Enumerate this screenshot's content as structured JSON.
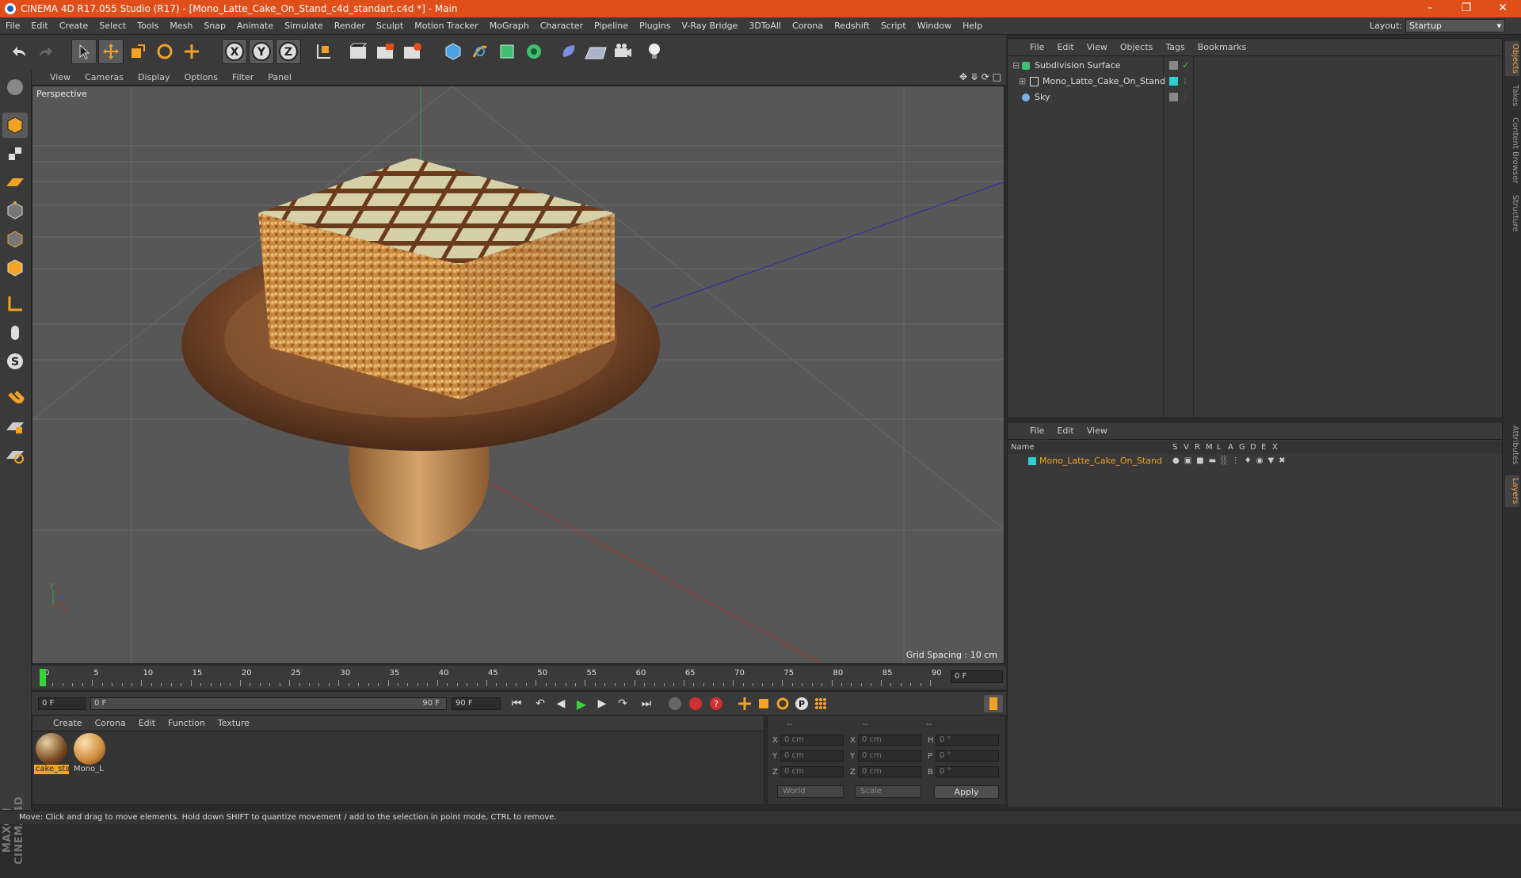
{
  "app": {
    "title": "CINEMA 4D R17.055 Studio (R17) - [Mono_Latte_Cake_On_Stand_c4d_standart.c4d *] - Main",
    "accent": "#e04e1a"
  },
  "menubar": {
    "items": [
      "File",
      "Edit",
      "Create",
      "Select",
      "Tools",
      "Mesh",
      "Snap",
      "Animate",
      "Simulate",
      "Render",
      "Sculpt",
      "Motion Tracker",
      "MoGraph",
      "Character",
      "Pipeline",
      "Plugins",
      "V-Ray Bridge",
      "3DToAll",
      "Corona",
      "Redshift",
      "Script",
      "Window",
      "Help"
    ],
    "layout_label": "Layout:",
    "layout_value": "Startup"
  },
  "toolbar": {
    "icons": [
      "undo-icon",
      "redo-icon",
      "select-icon",
      "move-icon",
      "scale-icon",
      "rotate-icon",
      "transform-icon",
      "x-axis-icon",
      "y-axis-icon",
      "z-axis-icon",
      "coord-system-icon",
      "render-view-icon",
      "render-picture-viewer-icon",
      "render-settings-icon",
      "cube-icon",
      "pen-icon",
      "subdivision-icon",
      "cloner-icon",
      "deformer-icon",
      "floor-icon",
      "camera-icon",
      "light-icon"
    ]
  },
  "viewport": {
    "menu": [
      "View",
      "Cameras",
      "Display",
      "Options",
      "Filter",
      "Panel"
    ],
    "label": "Perspective",
    "grid_spacing": "Grid Spacing : 10 cm"
  },
  "timeline": {
    "ticks": [
      "0",
      "5",
      "10",
      "15",
      "20",
      "25",
      "30",
      "35",
      "40",
      "45",
      "50",
      "55",
      "60",
      "65",
      "70",
      "75",
      "80",
      "85",
      "90"
    ],
    "current_frame": "0 F",
    "start_field": "0 F",
    "slider_start": "0 F",
    "slider_end": "90 F",
    "end_field": "90 F"
  },
  "materials": {
    "menu": [
      "Create",
      "Corona",
      "Edit",
      "Function",
      "Texture"
    ],
    "items": [
      {
        "label": "cake_sta",
        "selected": true
      },
      {
        "label": "Mono_L",
        "selected": false
      }
    ]
  },
  "coords": {
    "headers": [
      "--",
      "--",
      "--"
    ],
    "rows": [
      {
        "a": "X",
        "av": "0 cm",
        "b": "X",
        "bv": "0 cm",
        "c": "H",
        "cv": "0 °"
      },
      {
        "a": "Y",
        "av": "0 cm",
        "b": "Y",
        "bv": "0 cm",
        "c": "P",
        "cv": "0 °"
      },
      {
        "a": "Z",
        "av": "0 cm",
        "b": "Z",
        "bv": "0 cm",
        "c": "B",
        "cv": "0 °"
      }
    ],
    "world": "World",
    "scale": "Scale",
    "apply": "Apply"
  },
  "object_manager": {
    "menu": [
      "File",
      "Edit",
      "View",
      "Objects",
      "Tags",
      "Bookmarks"
    ],
    "objects": [
      {
        "name": "Subdivision Surface",
        "indent": 0
      },
      {
        "name": "Mono_Latte_Cake_On_Stand",
        "indent": 1
      },
      {
        "name": "Sky",
        "indent": 0
      }
    ]
  },
  "layer_manager": {
    "menu": [
      "File",
      "Edit",
      "View"
    ],
    "columns": [
      "Name",
      "S",
      "V",
      "R",
      "M",
      "L",
      "A",
      "G",
      "D",
      "E",
      "X"
    ],
    "layers": [
      {
        "name": "Mono_Latte_Cake_On_Stand",
        "color": "#2ecfd0"
      }
    ]
  },
  "right_tabs": [
    "Objects",
    "Takes",
    "Content Browser",
    "Structure",
    "Attributes",
    "Layers"
  ],
  "status": "Move: Click and drag to move elements. Hold down SHIFT to quantize movement / add to the selection in point mode, CTRL to remove.",
  "brand": "MAXON CINEMA 4D"
}
